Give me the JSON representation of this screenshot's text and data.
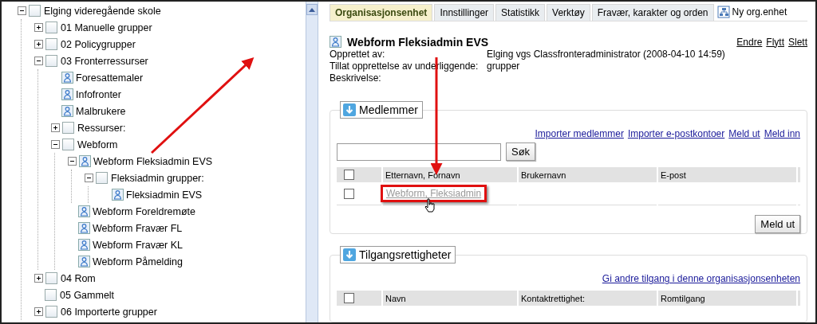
{
  "tree": [
    {
      "label": "Elging videregående skole",
      "kind": "group",
      "expanded": true,
      "children": [
        {
          "label": "01 Manuelle grupper",
          "kind": "group",
          "expanded": false
        },
        {
          "label": "02 Policygrupper",
          "kind": "group",
          "expanded": false
        },
        {
          "label": "03 Fronterressurser",
          "kind": "group",
          "expanded": true,
          "children": [
            {
              "label": "Foresattemaler",
              "kind": "user"
            },
            {
              "label": "Infofronter",
              "kind": "user"
            },
            {
              "label": "Malbrukere",
              "kind": "user"
            },
            {
              "label": "Ressurser:",
              "kind": "group",
              "expanded": false
            },
            {
              "label": "Webform",
              "kind": "group",
              "expanded": true,
              "children": [
                {
                  "label": "Webform Fleksiadmin EVS",
                  "kind": "user",
                  "expanded": true,
                  "children": [
                    {
                      "label": "Fleksiadmin grupper:",
                      "kind": "group",
                      "expanded": true,
                      "children": [
                        {
                          "label": "Fleksiadmin EVS",
                          "kind": "user"
                        }
                      ]
                    }
                  ]
                },
                {
                  "label": "Webform Foreldremøte",
                  "kind": "user"
                },
                {
                  "label": "Webform Fravær FL",
                  "kind": "user"
                },
                {
                  "label": "Webform Fravær KL",
                  "kind": "user"
                },
                {
                  "label": "Webform Påmelding",
                  "kind": "user"
                }
              ]
            }
          ]
        },
        {
          "label": "04 Rom",
          "kind": "group",
          "expanded": false
        },
        {
          "label": "05 Gammelt",
          "kind": "group"
        },
        {
          "label": "06 Importerte grupper",
          "kind": "group",
          "expanded": false
        }
      ]
    }
  ],
  "tabs": [
    {
      "label": "Organisasjonsenhet",
      "selected": true
    },
    {
      "label": "Innstillinger",
      "selected": false
    },
    {
      "label": "Statistikk",
      "selected": false
    },
    {
      "label": "Verktøy",
      "selected": false
    },
    {
      "label": "Fravær, karakter og orden",
      "selected": false
    }
  ],
  "new_button": "Ny org.enhet",
  "detail": {
    "title": "Webform Fleksiadmin EVS",
    "actions": [
      "Endre",
      "Flytt",
      "Slett"
    ],
    "fields": [
      {
        "label": "Opprettet av:",
        "value": "Elging vgs Classfronteradministrator (2008-04-10 14:59)"
      },
      {
        "label": "Tillat opprettelse av underliggende:",
        "value": "grupper"
      },
      {
        "label": "Beskrivelse:"
      }
    ]
  },
  "members": {
    "legend": "Medlemmer",
    "links": [
      "Importer medlemmer",
      "Importer e-postkontoer",
      "Meld ut",
      "Meld inn"
    ],
    "search_button": "Søk",
    "header_checked": false,
    "columns": [
      "Etternavn, Fornavn",
      "Brukernavn",
      "E-post"
    ],
    "rows": [
      {
        "checked": false,
        "name": "Webform, Fleksiadmin"
      }
    ],
    "button": "Meld ut"
  },
  "access": {
    "legend": "Tilgangsrettigheter",
    "link": "Gi andre tilgang i denne organisasjonsenheten",
    "header_checked": false,
    "columns": [
      "Navn",
      "Kontaktrettighet:",
      "Romtilgang"
    ]
  }
}
